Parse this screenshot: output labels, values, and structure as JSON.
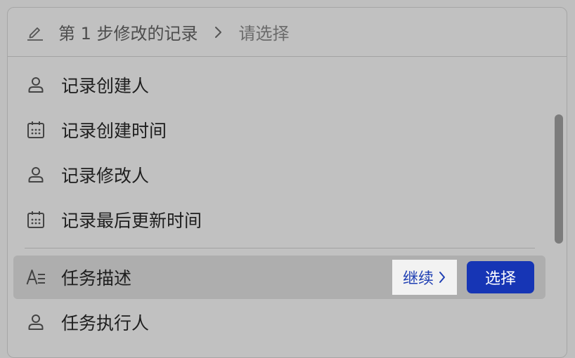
{
  "header": {
    "title": "第 1 步修改的记录",
    "placeholder": "请选择"
  },
  "fields": [
    {
      "label": "记录创建人",
      "icon": "person-icon"
    },
    {
      "label": "记录创建时间",
      "icon": "calendar-icon"
    },
    {
      "label": "记录修改人",
      "icon": "person-icon"
    },
    {
      "label": "记录最后更新时间",
      "icon": "calendar-icon"
    },
    {
      "label": "任务描述",
      "icon": "text-field-icon"
    },
    {
      "label": "任务执行人",
      "icon": "person-icon"
    }
  ],
  "active_row": {
    "continue_label": "继续",
    "select_label": "选择"
  },
  "colors": {
    "primary": "#1635b5",
    "continue_text": "#1f3fb3",
    "background": "#c1c1c1"
  }
}
